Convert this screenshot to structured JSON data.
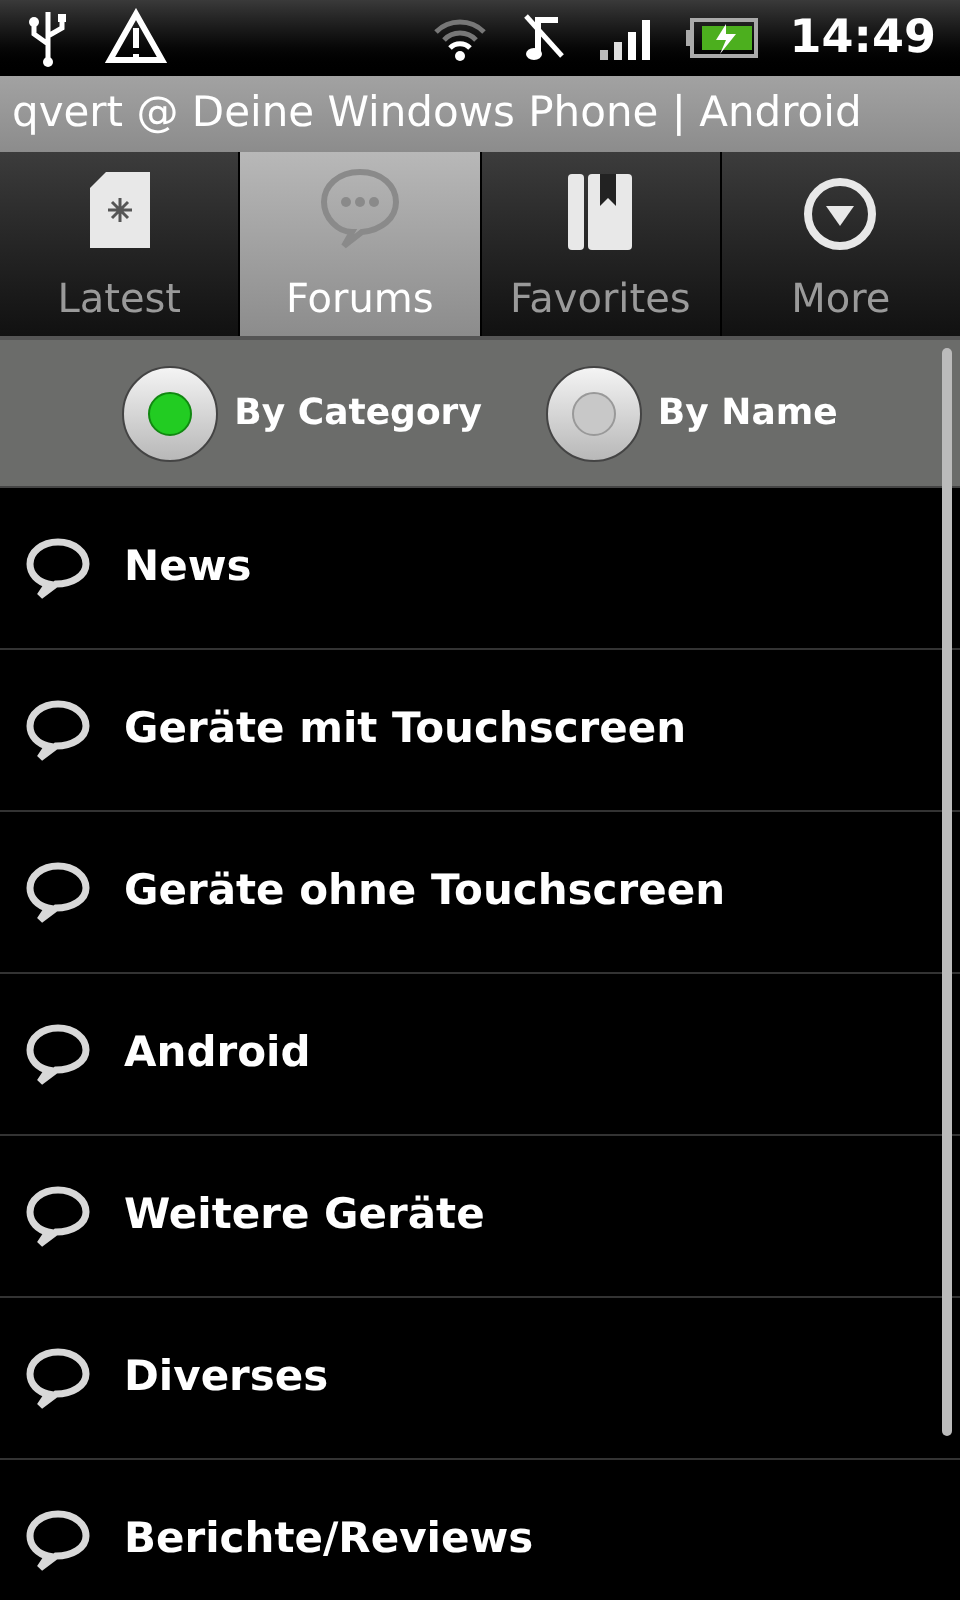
{
  "status_bar": {
    "time": "14:49"
  },
  "title_bar": {
    "title": "qvert @ Deine Windows Phone | Android"
  },
  "tabs": [
    {
      "label": "Latest",
      "kind": "latest",
      "selected": false
    },
    {
      "label": "Forums",
      "kind": "forums",
      "selected": true
    },
    {
      "label": "Favorites",
      "kind": "favorites",
      "selected": false
    },
    {
      "label": "More",
      "kind": "more",
      "selected": false
    }
  ],
  "sort_options": [
    {
      "label": "By Category",
      "selected": true
    },
    {
      "label": "By Name",
      "selected": false
    }
  ],
  "forums": [
    {
      "name": "News"
    },
    {
      "name": "Geräte mit Touchscreen"
    },
    {
      "name": "Geräte ohne Touchscreen"
    },
    {
      "name": "Android"
    },
    {
      "name": "Weitere Geräte"
    },
    {
      "name": "Diverses"
    },
    {
      "name": "Berichte/Reviews"
    }
  ]
}
